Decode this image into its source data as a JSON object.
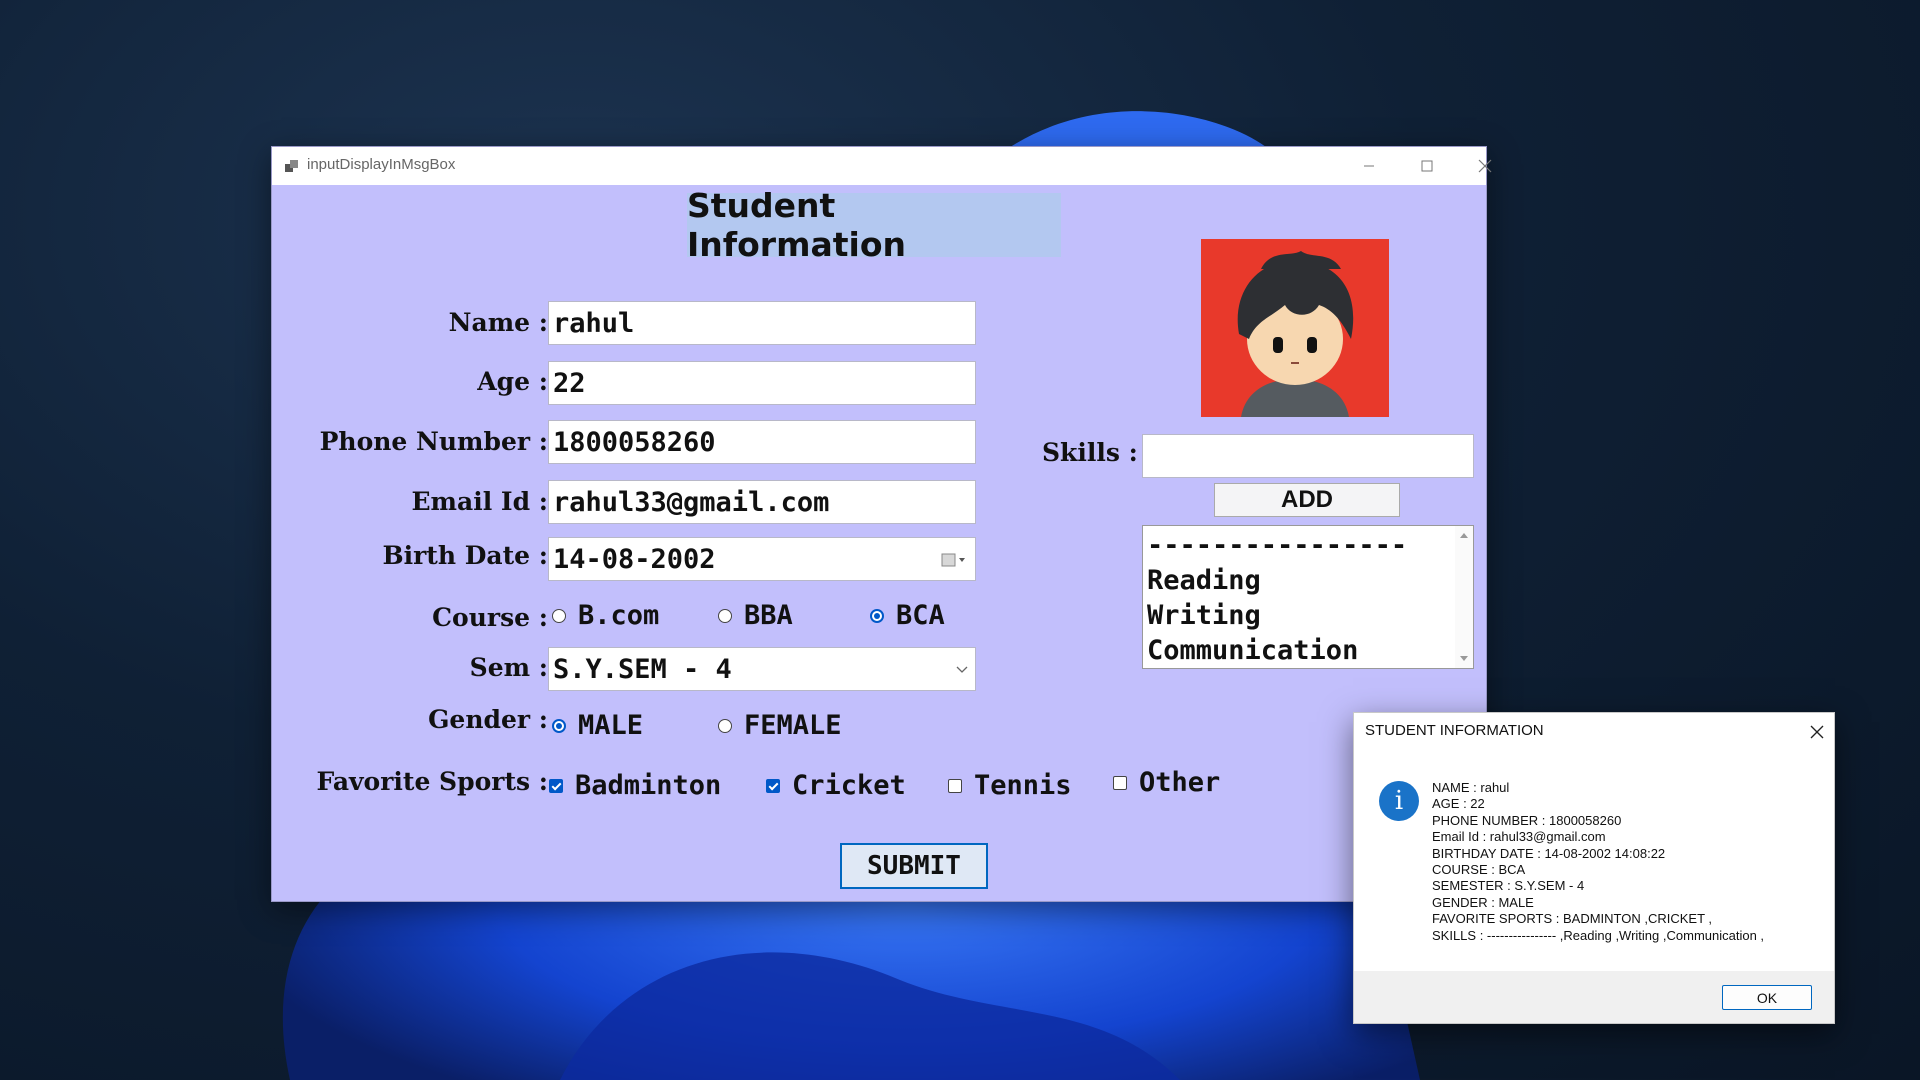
{
  "window": {
    "title": "inputDisplayInMsgBox"
  },
  "form": {
    "heading": "Student Information",
    "name_label": "Name :",
    "name_value": "rahul",
    "age_label": "Age :",
    "age_value": "22",
    "phone_label": "Phone Number :",
    "phone_value": "1800058260",
    "email_label": "Email Id :",
    "email_value": "rahul33@gmail.com",
    "birth_label": "Birth Date :",
    "birth_value": "14-08-2002",
    "course_label": "Course :",
    "course_options": [
      {
        "label": "B.com",
        "selected": false
      },
      {
        "label": "BBA",
        "selected": false
      },
      {
        "label": "BCA",
        "selected": true
      }
    ],
    "sem_label": "Sem :",
    "sem_value": "S.Y.SEM - 4",
    "gender_label": "Gender :",
    "gender_options": [
      {
        "label": "MALE",
        "selected": true
      },
      {
        "label": "FEMALE",
        "selected": false
      }
    ],
    "sports_label": "Favorite Sports :",
    "sports_options": [
      {
        "label": "Badminton",
        "checked": true
      },
      {
        "label": "Cricket",
        "checked": true
      },
      {
        "label": "Tennis",
        "checked": false
      },
      {
        "label": "Other",
        "checked": false
      }
    ],
    "submit_label": "SUBMIT",
    "skills_label": "Skills :",
    "skills_input_value": "",
    "add_label": "ADD",
    "skills_list": [
      "----------------",
      "Reading",
      "Writing",
      "Communication"
    ]
  },
  "dialog": {
    "title": "STUDENT INFORMATION",
    "icon": "info-icon",
    "lines": [
      "NAME : rahul",
      "AGE : 22",
      "PHONE NUMBER : 1800058260",
      "Email Id : rahul33@gmail.com",
      "BIRTHDAY DATE : 14-08-2002 14:08:22",
      "COURSE : BCA",
      "SEMESTER : S.Y.SEM - 4",
      "GENDER : MALE",
      "FAVORITE SPORTS : BADMINTON ,CRICKET ,",
      "SKILLS : ---------------- ,Reading ,Writing ,Communication ,"
    ],
    "ok_label": "OK"
  },
  "colors": {
    "form_bg": "#c2bffc",
    "heading_bg": "#b3c8f0",
    "accent": "#0058c8",
    "avatar_bg": "#e8392b"
  }
}
